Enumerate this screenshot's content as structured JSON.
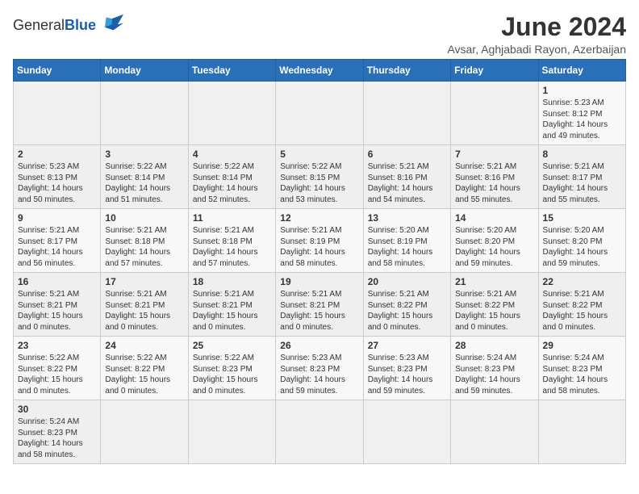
{
  "logo": {
    "text_general": "General",
    "text_blue": "Blue"
  },
  "title": {
    "month_year": "June 2024",
    "location": "Avsar, Aghjabadi Rayon, Azerbaijan"
  },
  "weekdays": [
    "Sunday",
    "Monday",
    "Tuesday",
    "Wednesday",
    "Thursday",
    "Friday",
    "Saturday"
  ],
  "weeks": [
    [
      {
        "day": null,
        "info": null
      },
      {
        "day": null,
        "info": null
      },
      {
        "day": null,
        "info": null
      },
      {
        "day": null,
        "info": null
      },
      {
        "day": null,
        "info": null
      },
      {
        "day": null,
        "info": null
      },
      {
        "day": "1",
        "info": "Sunrise: 5:23 AM\nSunset: 8:12 PM\nDaylight: 14 hours and 49 minutes."
      }
    ],
    [
      {
        "day": "2",
        "info": "Sunrise: 5:23 AM\nSunset: 8:13 PM\nDaylight: 14 hours and 50 minutes."
      },
      {
        "day": "3",
        "info": "Sunrise: 5:22 AM\nSunset: 8:14 PM\nDaylight: 14 hours and 51 minutes."
      },
      {
        "day": "4",
        "info": "Sunrise: 5:22 AM\nSunset: 8:14 PM\nDaylight: 14 hours and 52 minutes."
      },
      {
        "day": "5",
        "info": "Sunrise: 5:22 AM\nSunset: 8:15 PM\nDaylight: 14 hours and 53 minutes."
      },
      {
        "day": "6",
        "info": "Sunrise: 5:21 AM\nSunset: 8:16 PM\nDaylight: 14 hours and 54 minutes."
      },
      {
        "day": "7",
        "info": "Sunrise: 5:21 AM\nSunset: 8:16 PM\nDaylight: 14 hours and 55 minutes."
      },
      {
        "day": "8",
        "info": "Sunrise: 5:21 AM\nSunset: 8:17 PM\nDaylight: 14 hours and 55 minutes."
      }
    ],
    [
      {
        "day": "9",
        "info": "Sunrise: 5:21 AM\nSunset: 8:17 PM\nDaylight: 14 hours and 56 minutes."
      },
      {
        "day": "10",
        "info": "Sunrise: 5:21 AM\nSunset: 8:18 PM\nDaylight: 14 hours and 57 minutes."
      },
      {
        "day": "11",
        "info": "Sunrise: 5:21 AM\nSunset: 8:18 PM\nDaylight: 14 hours and 57 minutes."
      },
      {
        "day": "12",
        "info": "Sunrise: 5:21 AM\nSunset: 8:19 PM\nDaylight: 14 hours and 58 minutes."
      },
      {
        "day": "13",
        "info": "Sunrise: 5:20 AM\nSunset: 8:19 PM\nDaylight: 14 hours and 58 minutes."
      },
      {
        "day": "14",
        "info": "Sunrise: 5:20 AM\nSunset: 8:20 PM\nDaylight: 14 hours and 59 minutes."
      },
      {
        "day": "15",
        "info": "Sunrise: 5:20 AM\nSunset: 8:20 PM\nDaylight: 14 hours and 59 minutes."
      }
    ],
    [
      {
        "day": "16",
        "info": "Sunrise: 5:21 AM\nSunset: 8:21 PM\nDaylight: 15 hours and 0 minutes."
      },
      {
        "day": "17",
        "info": "Sunrise: 5:21 AM\nSunset: 8:21 PM\nDaylight: 15 hours and 0 minutes."
      },
      {
        "day": "18",
        "info": "Sunrise: 5:21 AM\nSunset: 8:21 PM\nDaylight: 15 hours and 0 minutes."
      },
      {
        "day": "19",
        "info": "Sunrise: 5:21 AM\nSunset: 8:21 PM\nDaylight: 15 hours and 0 minutes."
      },
      {
        "day": "20",
        "info": "Sunrise: 5:21 AM\nSunset: 8:22 PM\nDaylight: 15 hours and 0 minutes."
      },
      {
        "day": "21",
        "info": "Sunrise: 5:21 AM\nSunset: 8:22 PM\nDaylight: 15 hours and 0 minutes."
      },
      {
        "day": "22",
        "info": "Sunrise: 5:21 AM\nSunset: 8:22 PM\nDaylight: 15 hours and 0 minutes."
      }
    ],
    [
      {
        "day": "23",
        "info": "Sunrise: 5:22 AM\nSunset: 8:22 PM\nDaylight: 15 hours and 0 minutes."
      },
      {
        "day": "24",
        "info": "Sunrise: 5:22 AM\nSunset: 8:22 PM\nDaylight: 15 hours and 0 minutes."
      },
      {
        "day": "25",
        "info": "Sunrise: 5:22 AM\nSunset: 8:23 PM\nDaylight: 15 hours and 0 minutes."
      },
      {
        "day": "26",
        "info": "Sunrise: 5:23 AM\nSunset: 8:23 PM\nDaylight: 14 hours and 59 minutes."
      },
      {
        "day": "27",
        "info": "Sunrise: 5:23 AM\nSunset: 8:23 PM\nDaylight: 14 hours and 59 minutes."
      },
      {
        "day": "28",
        "info": "Sunrise: 5:24 AM\nSunset: 8:23 PM\nDaylight: 14 hours and 59 minutes."
      },
      {
        "day": "29",
        "info": "Sunrise: 5:24 AM\nSunset: 8:23 PM\nDaylight: 14 hours and 58 minutes."
      }
    ],
    [
      {
        "day": "30",
        "info": "Sunrise: 5:24 AM\nSunset: 8:23 PM\nDaylight: 14 hours and 58 minutes."
      },
      {
        "day": null,
        "info": null
      },
      {
        "day": null,
        "info": null
      },
      {
        "day": null,
        "info": null
      },
      {
        "day": null,
        "info": null
      },
      {
        "day": null,
        "info": null
      },
      {
        "day": null,
        "info": null
      }
    ]
  ]
}
